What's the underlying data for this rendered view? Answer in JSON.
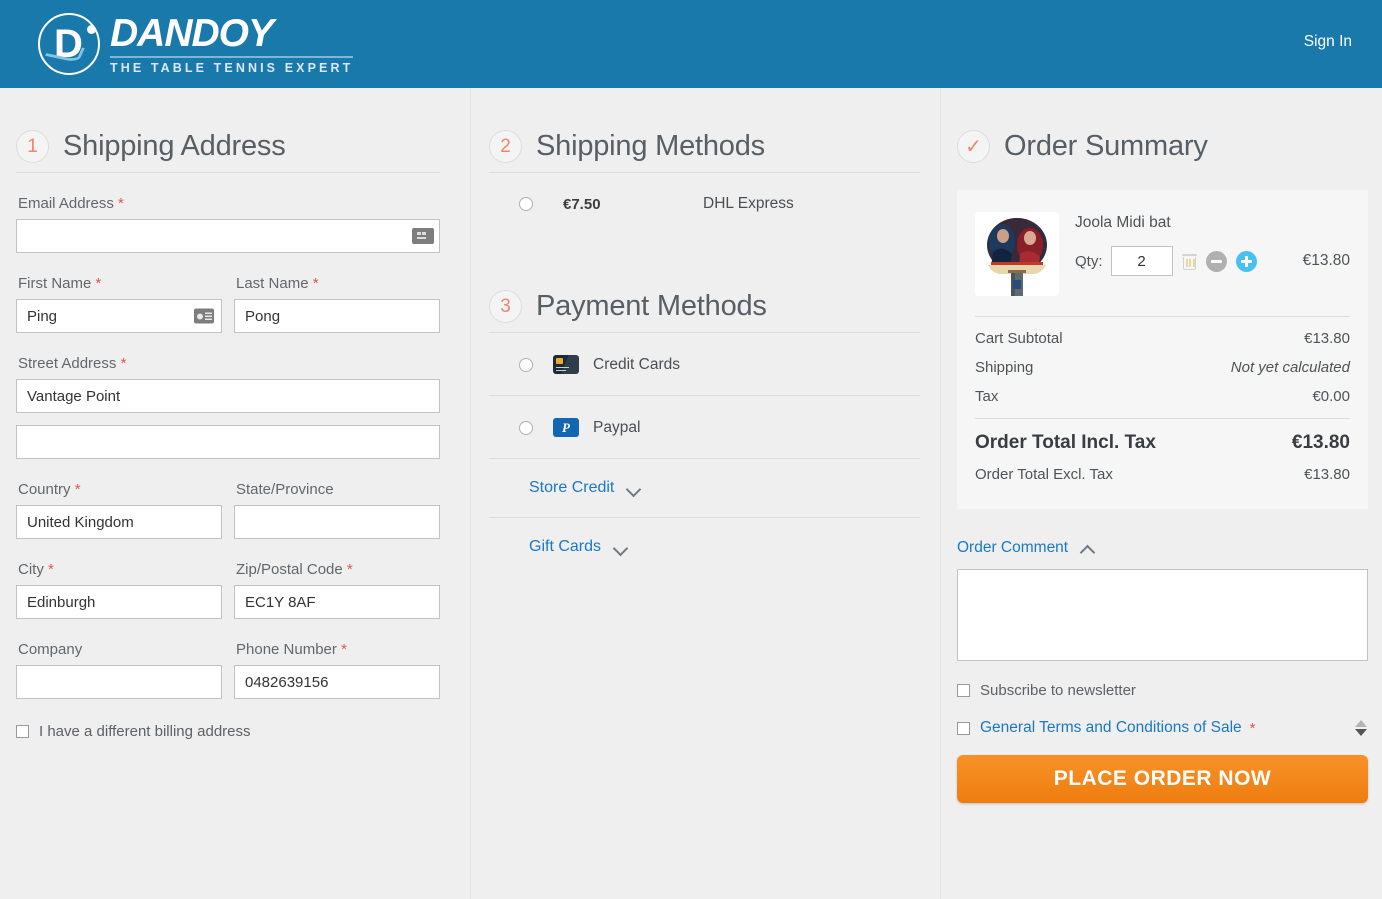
{
  "header": {
    "logo_name": "DANDOY",
    "logo_tagline": "THE TABLE TENNIS EXPERT",
    "sign_in": "Sign In",
    "brand_color": "#1979ab"
  },
  "shipping_address": {
    "step_number": "1",
    "title": "Shipping Address",
    "email_label": "Email Address",
    "email_value": "",
    "first_name_label": "First Name",
    "first_name_value": "Ping",
    "last_name_label": "Last Name",
    "last_name_value": "Pong",
    "street_label": "Street Address",
    "street_value": "Vantage Point",
    "street_line2_value": "",
    "country_label": "Country",
    "country_value": "United Kingdom",
    "state_label": "State/Province",
    "state_value": "",
    "city_label": "City",
    "city_value": "Edinburgh",
    "zip_label": "Zip/Postal Code",
    "zip_value": "EC1Y 8AF",
    "company_label": "Company",
    "company_value": "",
    "phone_label": "Phone Number",
    "phone_value": "0482639156",
    "billing_checkbox_label": "I have a different billing address",
    "required_marker": "*"
  },
  "shipping_methods": {
    "step_number": "2",
    "title": "Shipping Methods",
    "options": [
      {
        "price": "€7.50",
        "name": "DHL Express",
        "selected": false
      }
    ]
  },
  "payment_methods": {
    "step_number": "3",
    "title": "Payment Methods",
    "options": [
      {
        "label": "Credit Cards",
        "icon": "credit-card-icon",
        "selected": false
      },
      {
        "label": "Paypal",
        "icon": "paypal-icon",
        "selected": false
      }
    ],
    "collapsibles": [
      {
        "label": "Store Credit",
        "icon": "chevron-down-icon"
      },
      {
        "label": "Gift Cards",
        "icon": "chevron-down-icon"
      }
    ],
    "paypal_glyph": "P"
  },
  "order_summary": {
    "step_badge": "✓",
    "title": "Order Summary",
    "product": {
      "name": "Joola Midi bat",
      "qty_label": "Qty:",
      "qty_value": "2",
      "price": "€13.80"
    },
    "totals": [
      {
        "label": "Cart Subtotal",
        "value": "€13.80",
        "italic": false
      },
      {
        "label": "Shipping",
        "value": "Not yet calculated",
        "italic": true
      },
      {
        "label": "Tax",
        "value": "€0.00",
        "italic": false
      }
    ],
    "order_total_incl_label": "Order Total Incl. Tax",
    "order_total_incl_value": "€13.80",
    "order_total_excl_label": "Order Total Excl. Tax",
    "order_total_excl_value": "€13.80",
    "order_comment_label": "Order Comment",
    "order_comment_value": "",
    "newsletter_label": "Subscribe to newsletter",
    "terms_label": "General Terms and Conditions of Sale",
    "terms_required_marker": "*",
    "place_order_label": "PLACE ORDER NOW"
  }
}
